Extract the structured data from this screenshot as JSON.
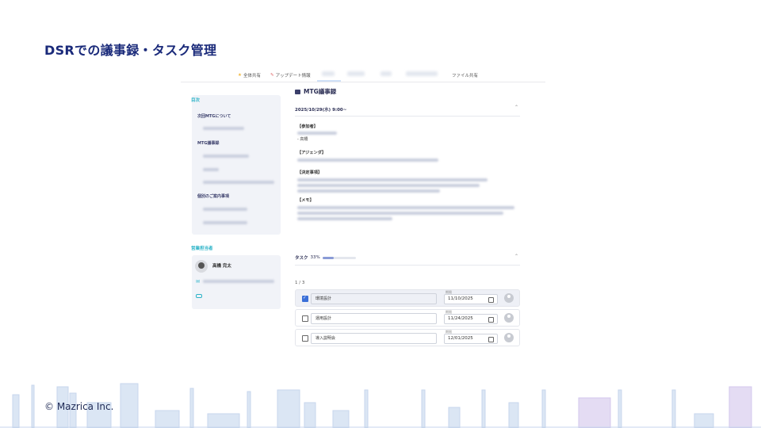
{
  "slide": {
    "title": "DSRでの議事録・タスク管理",
    "copyright": "© Mazrica Inc."
  },
  "tabs": [
    {
      "label": "全体共有",
      "icon": "star-icon",
      "icon_color": "#f2b73b"
    },
    {
      "label": "アップデート情報",
      "icon": "pencil-icon",
      "icon_color": "#e06b6b"
    },
    {
      "label": "ファイル共有"
    }
  ],
  "sidebar": {
    "toc_heading": "目次",
    "toc_items": [
      "次回MTGについて",
      "MTG議事録",
      "個別のご案内事項"
    ],
    "rep_heading": "営業担当者",
    "rep_name": "高橋 完太"
  },
  "main": {
    "title": "MTG議事録",
    "meeting_date": "2025/10/29(水) 9:00~",
    "sections": {
      "participants": "【参加者】",
      "participant_item": "- 高橋",
      "agenda": "【アジェンダ】",
      "decisions": "【決定事項】",
      "memo": "【メモ】"
    }
  },
  "tasks": {
    "label": "タスク",
    "percent_text": "33%",
    "progress": 0.33,
    "count": "1 / 3",
    "due_label": "期限",
    "items": [
      {
        "name": "環境設計",
        "due": "11/10/2025",
        "done": true
      },
      {
        "name": "運用設計",
        "due": "11/24/2025",
        "done": false
      },
      {
        "name": "導入説明会",
        "due": "12/01/2025",
        "done": false
      }
    ]
  },
  "colors": {
    "title": "#1a2a7a",
    "accent_teal": "#2bb3c7",
    "checkbox": "#3a6fd8"
  }
}
